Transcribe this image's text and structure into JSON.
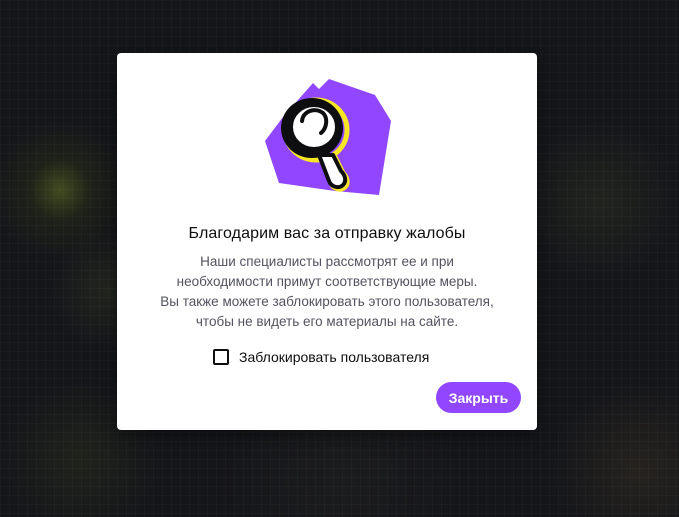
{
  "dialog": {
    "title": "Благодарим вас за отправку жалобы",
    "description_lines": [
      "Наши специалисты рассмотрят ее и при",
      "необходимости примут соответствующие меры.",
      "Вы также можете заблокировать этого пользователя,",
      "чтобы не видеть его материалы на сайте."
    ],
    "checkbox": {
      "label": "Заблокировать пользователя",
      "checked": false
    },
    "close_label": "Закрыть",
    "illustration_icon": "magnifying-glass-icon"
  },
  "colors": {
    "accent": "#9147ff",
    "highlight": "#f7e623",
    "text": "#0e0e10",
    "muted_text": "#53535f"
  }
}
